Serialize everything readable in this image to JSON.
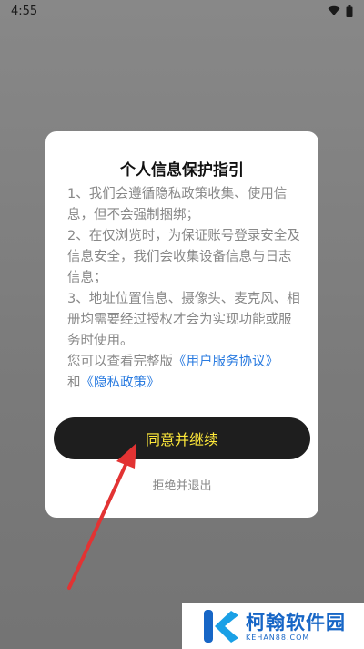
{
  "status_bar": {
    "time": "4:55"
  },
  "dialog": {
    "title": "个人信息保护指引",
    "paragraphs": [
      "1、我们会遵循隐私政策收集、使用信息，但不会强制捆绑；",
      "2、在仅浏览时，为保证账号登录安全及信息安全，我们会收集设备信息与日志信息；",
      "3、地址位置信息、摄像头、麦克风、相册均需要经过授权才会为实现功能或服务时使用。"
    ],
    "links_prefix": "您可以查看完整版",
    "link_user_agreement": "《用户服务协议》",
    "links_and": "和",
    "link_privacy": "《隐私政策》",
    "agree_button": "同意并继续",
    "reject_button": "拒绝并退出"
  },
  "watermark": {
    "title": "柯翰软件园",
    "subtitle": "KEHAN88.COM"
  },
  "colors": {
    "agree_text": "#ffe93a",
    "link": "#2a7be0",
    "arrow": "#e23333",
    "brand": "#1766c6"
  }
}
